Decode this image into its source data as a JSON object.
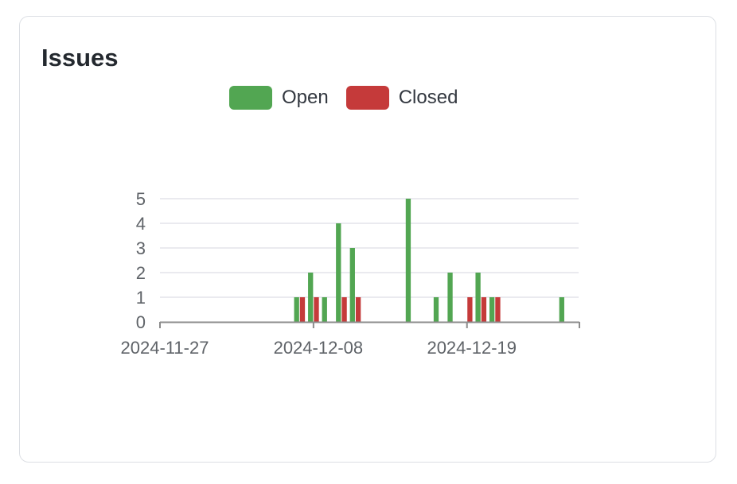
{
  "card": {
    "title": "Issues"
  },
  "colors": {
    "open": "#52a652",
    "closed": "#c53a3a",
    "grid": "#e3e4ea",
    "axis": "#8c8c8c"
  },
  "chart_data": {
    "type": "bar",
    "title": "",
    "xlabel": "",
    "ylabel": "",
    "ylim": [
      0,
      5
    ],
    "yticks": [
      0,
      1,
      2,
      3,
      4,
      5
    ],
    "x_tick_labels": [
      "2024-11-27",
      "2024-12-08",
      "2024-12-19"
    ],
    "xlim": [
      "2024-11-27",
      "2024-12-27"
    ],
    "grid": true,
    "legend_position": "top-center",
    "series": [
      {
        "name": "Open",
        "color": "#52a652",
        "points": [
          {
            "date": "2024-12-07",
            "value": 1
          },
          {
            "date": "2024-12-08",
            "value": 2
          },
          {
            "date": "2024-12-09",
            "value": 1
          },
          {
            "date": "2024-12-10",
            "value": 4
          },
          {
            "date": "2024-12-11",
            "value": 3
          },
          {
            "date": "2024-12-15",
            "value": 5
          },
          {
            "date": "2024-12-17",
            "value": 1
          },
          {
            "date": "2024-12-18",
            "value": 2
          },
          {
            "date": "2024-12-20",
            "value": 2
          },
          {
            "date": "2024-12-21",
            "value": 1
          },
          {
            "date": "2024-12-26",
            "value": 1
          }
        ]
      },
      {
        "name": "Closed",
        "color": "#c53a3a",
        "points": [
          {
            "date": "2024-12-07",
            "value": 1
          },
          {
            "date": "2024-12-08",
            "value": 1
          },
          {
            "date": "2024-12-10",
            "value": 1
          },
          {
            "date": "2024-12-11",
            "value": 1
          },
          {
            "date": "2024-12-19",
            "value": 1
          },
          {
            "date": "2024-12-20",
            "value": 1
          },
          {
            "date": "2024-12-21",
            "value": 1
          }
        ]
      }
    ]
  }
}
